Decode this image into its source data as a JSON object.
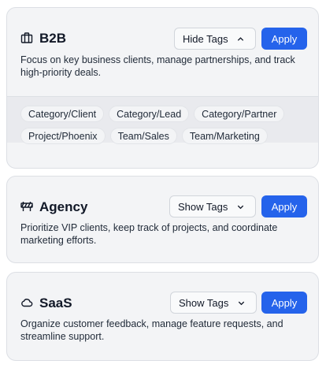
{
  "cards": [
    {
      "title": "B2B",
      "icon": "briefcase-icon",
      "toggle_label": "Hide Tags",
      "toggle_state": "expanded",
      "apply_label": "Apply",
      "description": "Focus on key business clients, manage partnerships, and track high-priority deals.",
      "tags_row1": [
        "Category/Client",
        "Category/Lead",
        "Category/Partner"
      ],
      "tags_row2": [
        "Project/Phoenix",
        "Team/Sales",
        "Team/Marketing"
      ]
    },
    {
      "title": "Agency",
      "icon": "roadblock-icon",
      "toggle_label": "Show Tags",
      "toggle_state": "collapsed",
      "apply_label": "Apply",
      "description": "Prioritize VIP clients, keep track of projects, and coordinate marketing efforts."
    },
    {
      "title": "SaaS",
      "icon": "cloud-icon",
      "toggle_label": "Show Tags",
      "toggle_state": "collapsed",
      "apply_label": "Apply",
      "description": "Organize customer feedback, manage feature requests, and streamline support."
    }
  ],
  "colors": {
    "accent": "#2563eb",
    "card_bg": "#f3f4f6",
    "tags_panel_bg": "#e9eaee"
  }
}
